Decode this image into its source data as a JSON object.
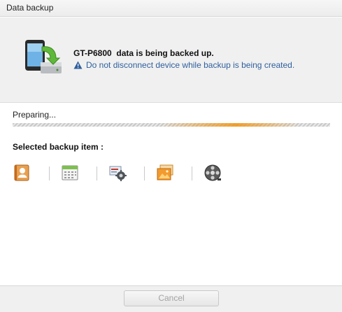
{
  "window": {
    "title": "Data backup"
  },
  "header": {
    "device_model": "GT-P6800",
    "message": "data is being backed up.",
    "warning": "Do not disconnect device while backup is being created."
  },
  "progress": {
    "status_text": "Preparing..."
  },
  "backup_items": {
    "label": "Selected backup item :",
    "icons": [
      "contacts-icon",
      "calendar-icon",
      "settings-icon",
      "photos-icon",
      "video-icon"
    ]
  },
  "footer": {
    "cancel_label": "Cancel",
    "cancel_enabled": false
  },
  "colors": {
    "accent_orange": "#f1981a",
    "warning_text": "#2f5f9e"
  }
}
